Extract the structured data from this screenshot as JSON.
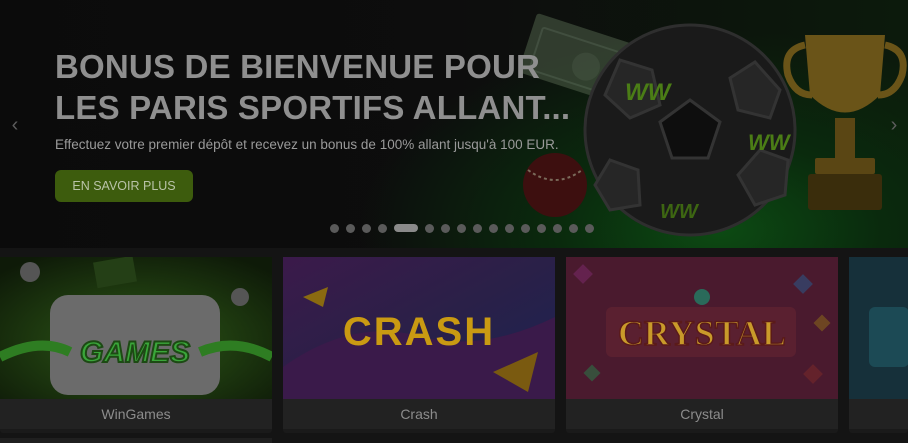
{
  "hero": {
    "title": "BONUS DE BIENVENUE POUR\nLES PARIS SPORTIFS ALLANT...",
    "subtitle": "Effectuez votre premier dépôt et recevez un bonus de 100% allant jusqu'à 100 EUR.",
    "cta_label": "EN SAVOIR PLUS",
    "ball_logo": "WW",
    "prev_icon": "chevron-left-icon",
    "next_icon": "chevron-right-icon",
    "arrow_prev": "‹",
    "arrow_next": "›",
    "slide_count": 16,
    "active_slide": 5
  },
  "games": [
    {
      "label": "WinGames",
      "art_text": "GAMES",
      "accent": "#3aa63a"
    },
    {
      "label": "Crash",
      "art_text": "CRASH",
      "accent": "#e6b800"
    },
    {
      "label": "Crystal",
      "art_text": "CRYSTAL",
      "accent": "#d9a521"
    }
  ],
  "colors": {
    "cta_bg": "#3d5c0d",
    "overlay": "dimmed"
  }
}
